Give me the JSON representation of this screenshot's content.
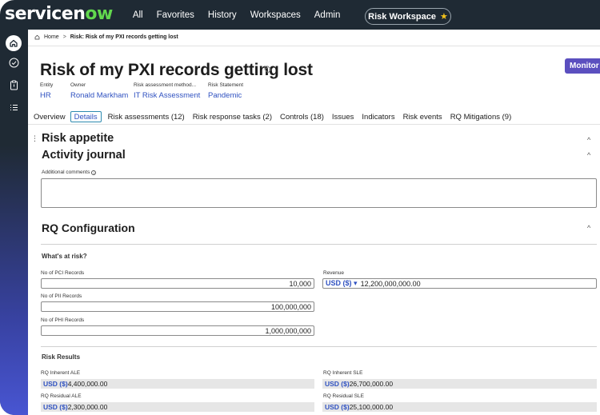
{
  "nav": {
    "logo_pre": "servicen",
    "logo_ow": "ow",
    "items": [
      "All",
      "Favorites",
      "History",
      "Workspaces",
      "Admin"
    ],
    "workspace_button": "Risk Workspace",
    "workspace_star": "★"
  },
  "breadcrumb": {
    "home": "Home",
    "separator": ">",
    "current": "Risk: Risk of my PXI records getting lost"
  },
  "record": {
    "title": "Risk of my PXI records getting lost",
    "monitor_button": "Monitor",
    "fields": [
      {
        "label": "Entity",
        "value": "HR"
      },
      {
        "label": "Owner",
        "value": "Ronald Markham"
      },
      {
        "label": "Risk assessment method...",
        "value": "IT Risk Assessment"
      },
      {
        "label": "Risk Statement",
        "value": "Pandemic"
      }
    ]
  },
  "tabs": [
    "Overview",
    "Details",
    "Risk assessments (12)",
    "Risk response tasks (2)",
    "Controls (18)",
    "Issues",
    "Indicators",
    "Risk events",
    "RQ Mitigations (9)"
  ],
  "active_tab": "Details",
  "sections": {
    "risk_appetite": "Risk appetite",
    "activity_journal": "Activity journal",
    "additional_comments_label": "Additional comments",
    "additional_comments_value": "",
    "rq_configuration": "RQ Configuration",
    "whats_at_risk": "What's at risk?",
    "risk_results": "Risk Results"
  },
  "at_risk": {
    "pci_label": "No of PCI Records",
    "pci_value": "10,000",
    "pii_label": "No of PII Records",
    "pii_value": "100,000,000",
    "phi_label": "No of PHI Records",
    "phi_value": "1,000,000,000",
    "revenue_label": "Revenue",
    "revenue_currency": "USD ($)",
    "revenue_value": "12,200,000,000.00"
  },
  "results": {
    "inherent_ale_label": "RQ Inherent ALE",
    "inherent_ale_currency": "USD ($)",
    "inherent_ale_value": "4,400,000.00",
    "residual_ale_label": "RQ Residual ALE",
    "residual_ale_currency": "USD ($)",
    "residual_ale_value": "2,300,000.00",
    "inherent_sle_label": "RQ Inherent SLE",
    "inherent_sle_currency": "USD ($)",
    "inherent_sle_value": "26,700,000.00",
    "residual_sle_label": "RQ Residual SLE",
    "residual_sle_currency": "USD ($)",
    "residual_sle_value": "25,100,000.00"
  },
  "icons": {
    "chevron_up": "^",
    "drag_handle": "⋮",
    "dropdown_caret": "▾"
  }
}
